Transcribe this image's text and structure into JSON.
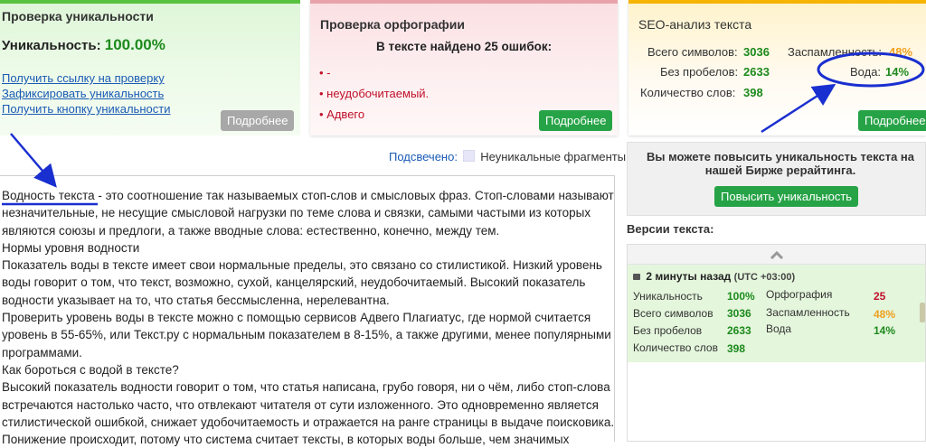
{
  "uniqueness_panel": {
    "title": "Проверка уникальности",
    "uniq_label": "Уникальность:",
    "uniq_value": "100.00%",
    "links": [
      "Получить ссылку на проверку",
      "Зафиксировать уникальность",
      "Получить кнопку уникальности"
    ],
    "more_button": "Подробнее"
  },
  "spelling_panel": {
    "title": "Проверка орфографии",
    "summary": "В тексте найдено 25 ошибок:",
    "errors": [
      "-",
      "неудобочитаемый.",
      "Адвего"
    ],
    "more_button": "Подробнее"
  },
  "seo_panel": {
    "title": "SEO-анализ текста",
    "total_chars_label": "Всего символов:",
    "total_chars": "3036",
    "no_spaces_label": "Без пробелов:",
    "no_spaces": "2633",
    "words_label": "Количество слов:",
    "words": "398",
    "spam_label": "Заспамленность:",
    "spam": "48%",
    "water_label": "Вода:",
    "water": "14%",
    "more_button": "Подробнее"
  },
  "text_area": {
    "highlight_label": "Подсвечено:",
    "legend_label": "Неуникальные фрагменты",
    "lines": [
      "Водность текста - это соотношение так называемых стоп-слов и смысловых фраз. Стоп-словами называют",
      "незначительные, не несущие смысловой нагрузки по теме слова и связки, самыми частыми из которых",
      "являются союзы и предлоги, а также вводные слова: естественно, конечно, между тем.",
      "Нормы уровня водности",
      "Показатель воды в тексте имеет свои нормальные пределы, это связано со стилистикой. Низкий уровень",
      "воды говорит о том, что текст, возможно, сухой, канцелярский, неудобочитаемый. Высокий показатель",
      "водности указывает на то, что статья бессмысленна, нерелевантна.",
      "Проверить уровень воды в тексте можно с помощью сервисов Адвего Плагиатус, где нормой считается",
      "уровень в 55-65%, или Текст.ру с нормальным показателем в 8-15%, а также другими, менее популярными",
      "программами.",
      "Как бороться с водой в тексте?",
      "Высокий показатель водности говорит о том, что статья написана, грубо говоря, ни о чём, либо стоп-слова",
      "встречаются настолько часто, что отвлекают читателя от сути изложенного. Это одновременно является",
      "стилистической ошибкой, снижает удобочитаемость и отражается на ранге страницы в выдаче поисковика.",
      "Понижение происходит, потому что система считает тексты, в которых воды больше, чем значимых"
    ]
  },
  "promo": {
    "text": "Вы можете повысить уникальность текста на нашей Бирже рерайтинга.",
    "button": "Повысить уникальность"
  },
  "versions": {
    "title": "Версии текста:",
    "entry": {
      "time": "2 минуты назад",
      "tz": "(UTC +03:00)",
      "uniq_label": "Уникальность",
      "uniq": "100%",
      "total_label": "Всего символов",
      "total": "3036",
      "nospace_label": "Без пробелов",
      "nospace": "2633",
      "words_label": "Количество слов",
      "words": "398",
      "spell_label": "Орфография",
      "spell": "25",
      "spam_label": "Заспамленность",
      "spam": "48%",
      "water_label": "Вода",
      "water": "14%"
    }
  },
  "colors": {
    "annotation": "#1a2fd0",
    "green_value": "#1d8a1d",
    "button_green": "#27a347"
  }
}
